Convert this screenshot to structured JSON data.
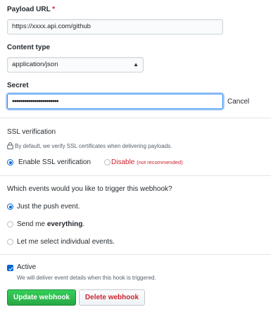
{
  "form": {
    "payload_url": {
      "label": "Payload URL",
      "required_mark": "*",
      "value": "https://xxxx.api.com/github"
    },
    "content_type": {
      "label": "Content type",
      "selected": "application/json"
    },
    "secret": {
      "label": "Secret",
      "value_masked": "•••••••••••••••••••••••",
      "cancel_label": "Cancel"
    }
  },
  "ssl": {
    "heading": "SSL verification",
    "description": "By default, we verify SSL certificates when delivering payloads.",
    "enable_label": "Enable SSL verification",
    "disable_label": "Disable",
    "disable_note": "(not recommended)"
  },
  "events": {
    "heading": "Which events would you like to trigger this webhook?",
    "option_push": "Just the push event.",
    "option_everything_prefix": "Send me ",
    "option_everything_bold": "everything",
    "option_everything_suffix": ".",
    "option_individual": "Let me select individual events.",
    "selected": "push"
  },
  "active": {
    "label": "Active",
    "description": "We will deliver event details when this hook is triggered.",
    "checked": true
  },
  "buttons": {
    "update": "Update webhook",
    "delete": "Delete webhook"
  },
  "colors": {
    "primary_blue": "#0366d6",
    "danger_red": "#cb2431",
    "success_green": "#28a745"
  }
}
